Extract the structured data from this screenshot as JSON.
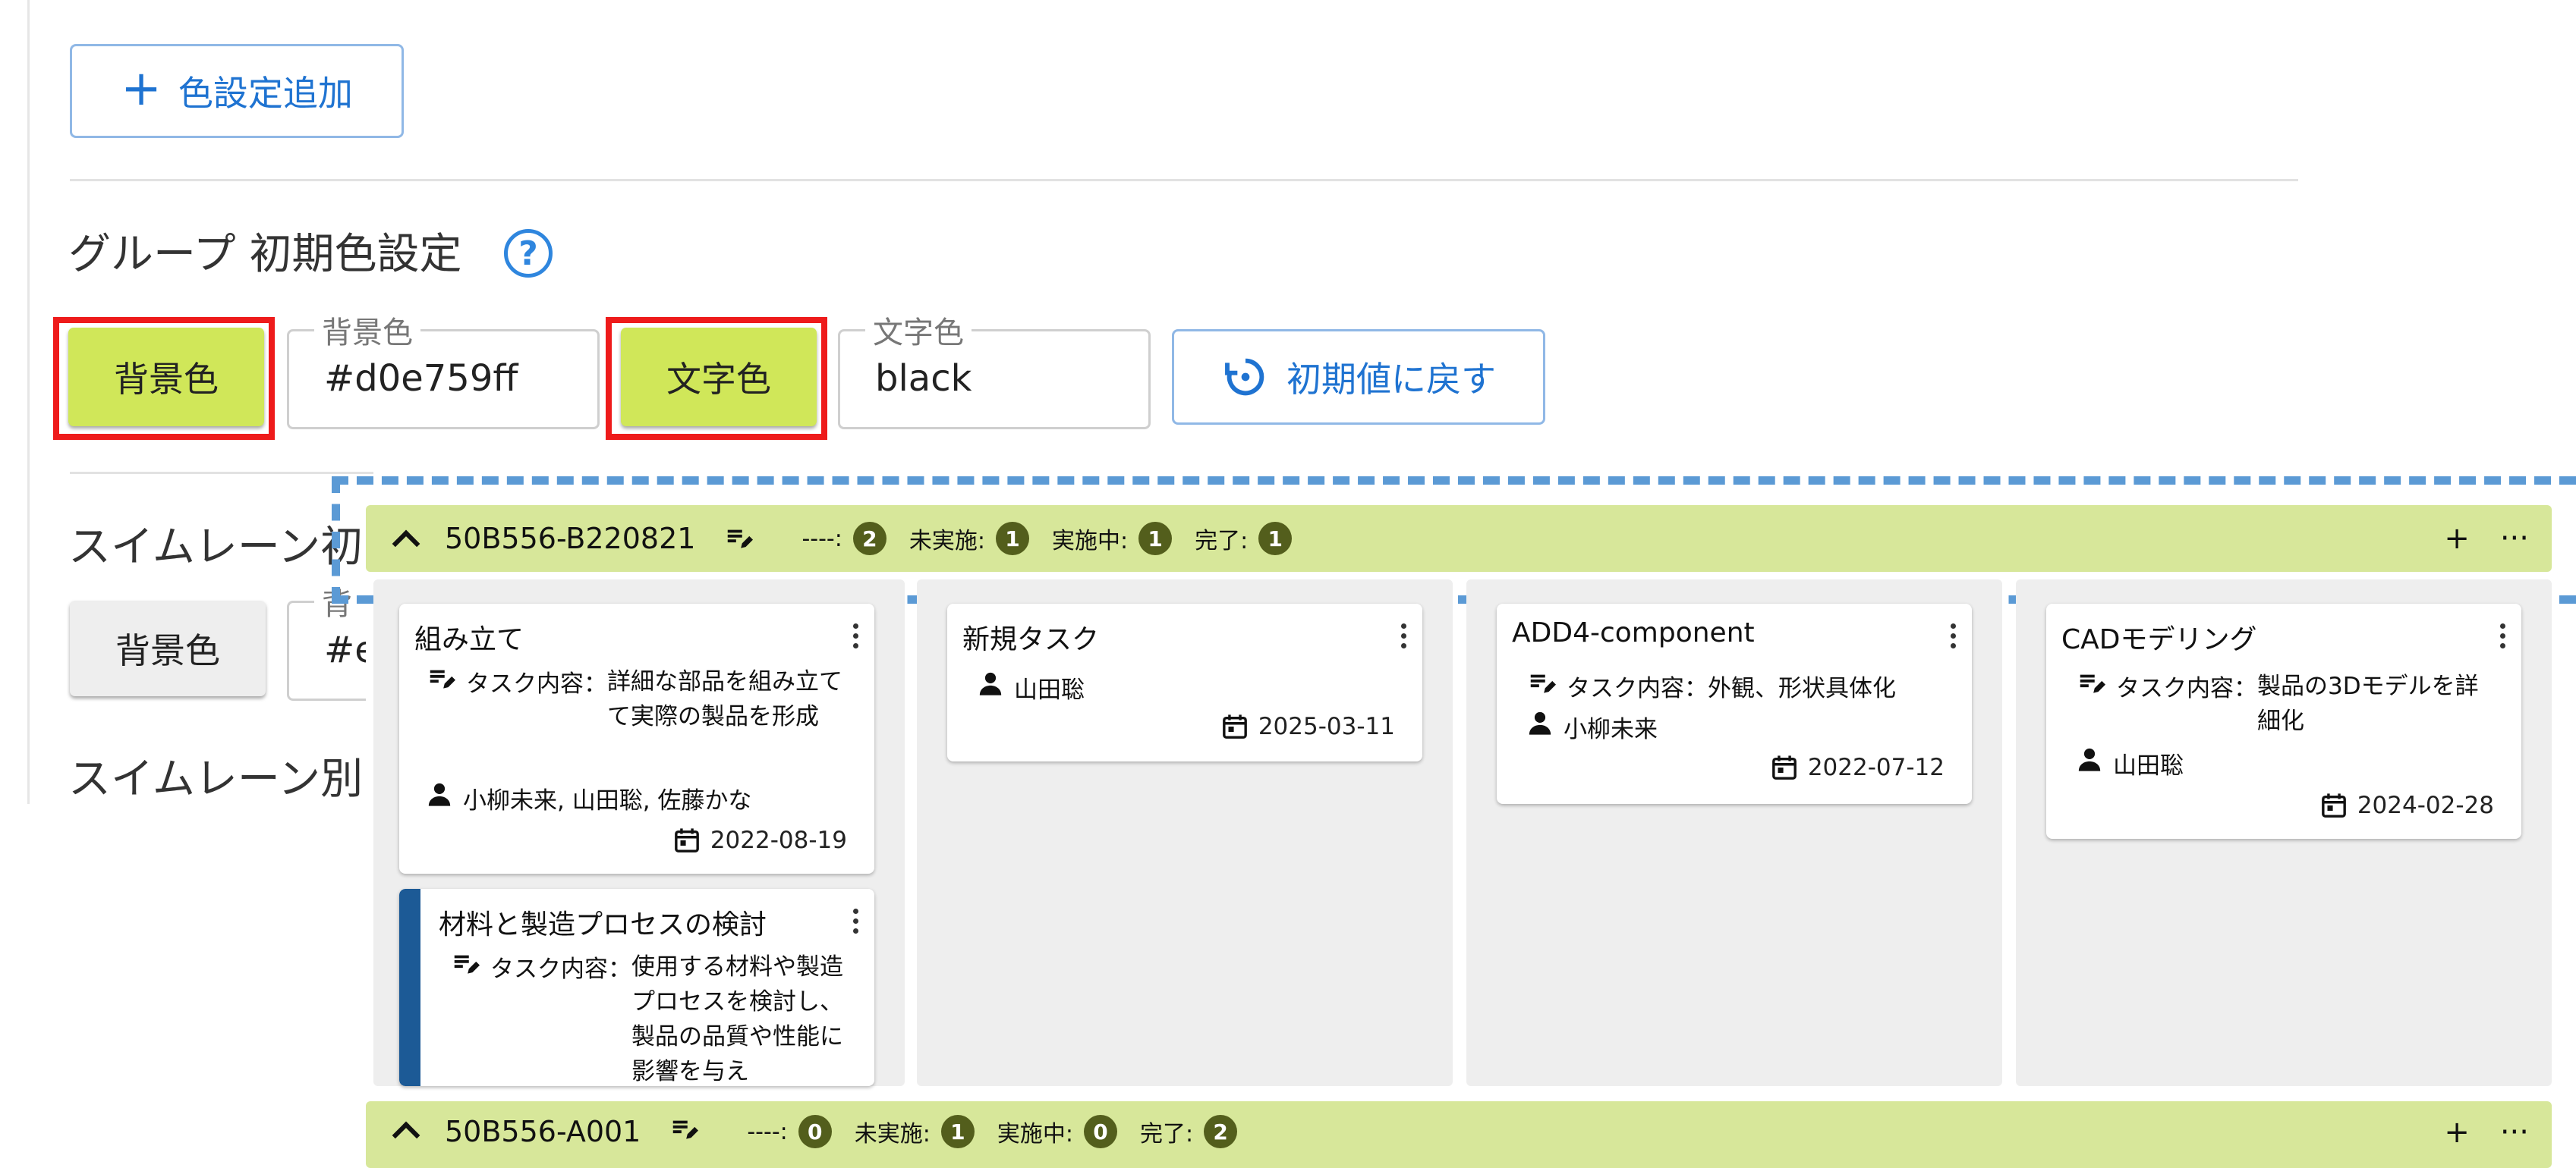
{
  "settings": {
    "add_color_label": "色設定追加",
    "group_heading": "グループ 初期色設定",
    "bg_button_label": "背景色",
    "bg_field_label": "背景色",
    "bg_field_value": "#d0e759ff",
    "text_button_label": "文字色",
    "text_field_label": "文字色",
    "text_field_value": "black",
    "reset_label": "初期値に戻す",
    "swimlane_heading": "スイムレーン初",
    "swimlane_bg_button_label": "背景色",
    "swimlane_bg_field_value": "#e",
    "swimlane_bg_field_label": "背",
    "swimlane_heading2": "スイムレーン別"
  },
  "colors": {
    "accent": "#1f73d1",
    "group_bg": "#d0e759",
    "lane_header_bg": "#d7e79a",
    "highlight": "#ee1b1b",
    "dash": "#5b9ad5",
    "badge": "#535e1c"
  },
  "lanes": [
    {
      "title": "50B556-B220821",
      "stats": [
        {
          "label": "----:",
          "count": "2"
        },
        {
          "label": "未実施:",
          "count": "1"
        },
        {
          "label": "実施中:",
          "count": "1"
        },
        {
          "label": "完了:",
          "count": "1"
        }
      ]
    },
    {
      "title": "50B556-A001",
      "stats": [
        {
          "label": "----:",
          "count": "0"
        },
        {
          "label": "未実施:",
          "count": "1"
        },
        {
          "label": "実施中:",
          "count": "0"
        },
        {
          "label": "完了:",
          "count": "2"
        }
      ]
    }
  ],
  "lane_actions": {
    "add": "+",
    "more": "···"
  },
  "cards": [
    {
      "title": "組み立て",
      "desc_label": "タスク内容：",
      "desc_text": "詳細な部品を組み立てて実際の製品を形成",
      "assignees": "小柳未来, 山田聡, 佐藤かな",
      "date": "2022-08-19"
    },
    {
      "title": "材料と製造プロセスの検討",
      "desc_label": "タスク内容：",
      "desc_text": "使用する材料や製造プロセスを検討し、製品の品質や性能に影響を与え"
    },
    {
      "title": "新規タスク",
      "assignees": "山田聡",
      "date": "2025-03-11"
    },
    {
      "title": "ADD4-component",
      "desc_label": "タスク内容：",
      "desc_text": "外観、形状具体化",
      "assignees": "小柳未来",
      "date": "2022-07-12"
    },
    {
      "title": "CADモデリング",
      "desc_label": "タスク内容：",
      "desc_text": "製品の3Dモデルを詳細化",
      "assignees": "山田聡",
      "date": "2024-02-28"
    }
  ]
}
